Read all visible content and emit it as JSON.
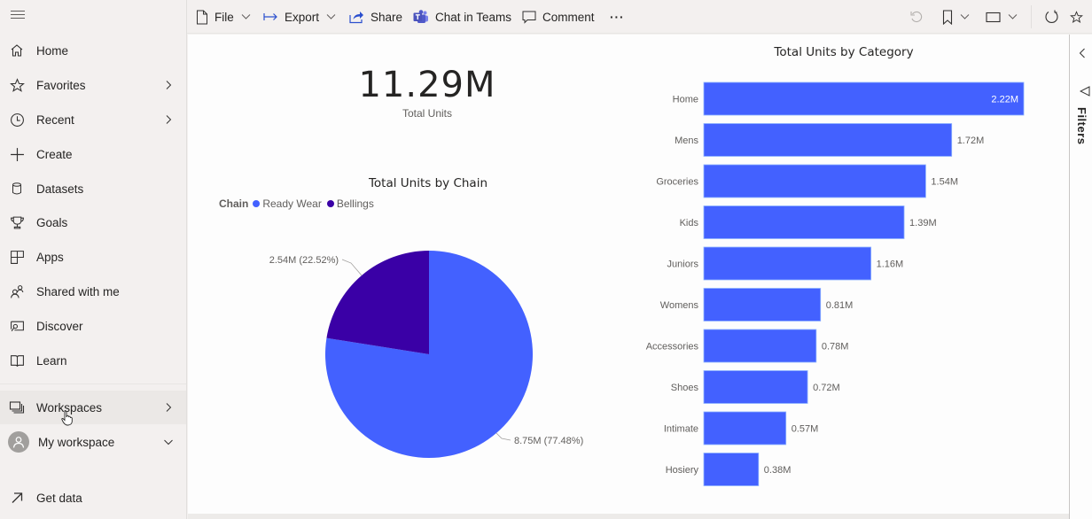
{
  "sidebar": {
    "menu_icon": "hamburger-icon",
    "items": [
      {
        "label": "Home",
        "icon": "home-icon"
      },
      {
        "label": "Favorites",
        "icon": "star-icon",
        "chevron": "chevron-right"
      },
      {
        "label": "Recent",
        "icon": "clock-icon",
        "chevron": "chevron-right"
      },
      {
        "label": "Create",
        "icon": "plus-icon"
      },
      {
        "label": "Datasets",
        "icon": "database-icon"
      },
      {
        "label": "Goals",
        "icon": "trophy-icon"
      },
      {
        "label": "Apps",
        "icon": "apps-icon"
      },
      {
        "label": "Shared with me",
        "icon": "people-icon"
      },
      {
        "label": "Discover",
        "icon": "discover-icon"
      },
      {
        "label": "Learn",
        "icon": "book-icon"
      }
    ],
    "workspaces": {
      "label": "Workspaces",
      "icon": "workspaces-icon",
      "chevron": "chevron-right"
    },
    "my_workspace": {
      "label": "My workspace",
      "icon": "avatar-icon",
      "chevron": "chevron-down"
    },
    "get_data": {
      "label": "Get data",
      "icon": "arrow-up-right-icon"
    }
  },
  "toolbar": {
    "file": "File",
    "export": "Export",
    "share": "Share",
    "chat_in_teams": "Chat in Teams",
    "comment": "Comment",
    "more": "···"
  },
  "filters_pane": {
    "label": "Filters"
  },
  "kpi": {
    "value": "11.29M",
    "label": "Total Units"
  },
  "colors": {
    "accent_blue": "#4361ff",
    "dark_purple": "#3a00a6"
  },
  "chart_data": [
    {
      "type": "pie",
      "title": "Total Units by Chain",
      "legend_title": "Chain",
      "legend_position": "top-left",
      "slices": [
        {
          "name": "Ready Wear",
          "value": 8.75,
          "percent": 77.48,
          "label": "8.75M (77.48%)",
          "color": "#4361ff"
        },
        {
          "name": "Bellings",
          "value": 2.54,
          "percent": 22.52,
          "label": "2.54M (22.52%)",
          "color": "#3a00a6"
        }
      ],
      "units": "M"
    },
    {
      "type": "bar",
      "orientation": "horizontal",
      "title": "Total Units by Category",
      "categories": [
        "Home",
        "Mens",
        "Groceries",
        "Kids",
        "Juniors",
        "Womens",
        "Accessories",
        "Shoes",
        "Intimate",
        "Hosiery"
      ],
      "values": [
        2.22,
        1.72,
        1.54,
        1.39,
        1.16,
        0.81,
        0.78,
        0.72,
        0.57,
        0.38
      ],
      "labels": [
        "2.22M",
        "1.72M",
        "1.54M",
        "1.39M",
        "1.16M",
        "0.81M",
        "0.78M",
        "0.72M",
        "0.57M",
        "0.38M"
      ],
      "xlabel": "",
      "ylabel": "",
      "xlim": [
        0,
        2.22
      ],
      "grid": false,
      "color": "#4361ff"
    }
  ]
}
